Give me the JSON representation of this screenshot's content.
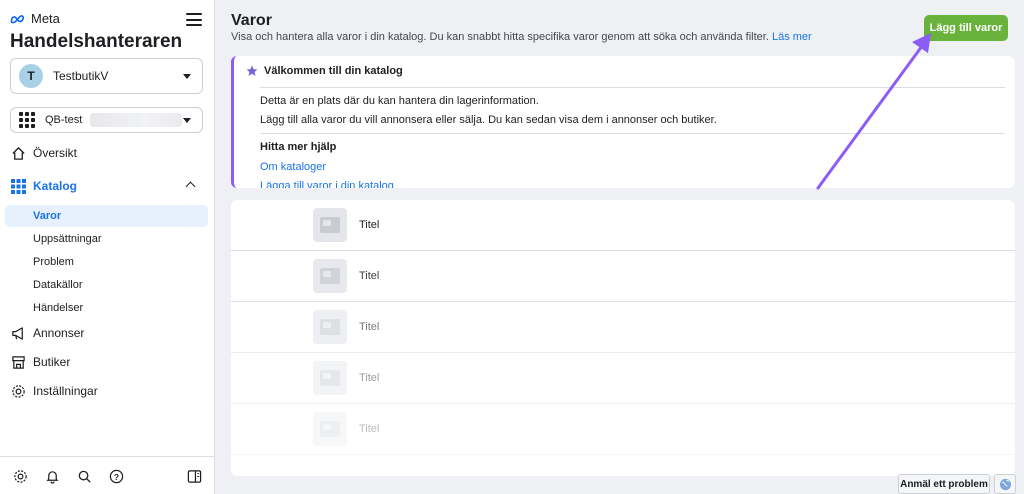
{
  "sidebar": {
    "brand": "Meta",
    "app_title": "Handelshanteraren",
    "account": {
      "avatar_letter": "T",
      "name": "TestbutikV"
    },
    "catalog": {
      "name": "QB-test"
    },
    "nav": {
      "overview": "Översikt",
      "catalog": "Katalog",
      "ads": "Annonser",
      "shops": "Butiker",
      "settings": "Inställningar"
    },
    "catalog_sub": [
      "Varor",
      "Uppsättningar",
      "Problem",
      "Datakällor",
      "Händelser"
    ],
    "bottom_icons": [
      "gear-icon",
      "bell-icon",
      "search-icon",
      "help-icon",
      "panel-icon"
    ]
  },
  "main": {
    "title": "Varor",
    "description": "Visa och hantera alla varor i din katalog. Du kan snabbt hitta specifika varor genom att söka och använda filter.",
    "learn_more": "Läs mer",
    "add_button": "Lägg till varor",
    "welcome": {
      "heading": "Välkommen till din katalog",
      "line1": "Detta är en plats där du kan hantera din lagerinformation.",
      "line2": "Lägg till alla varor du vill annonsera eller sälja. Du kan sedan visa dem i annonser och butiker.",
      "help_heading": "Hitta mer hjälp",
      "link1": "Om kataloger",
      "link2": "Lägga till varor i din katalog"
    },
    "items": [
      {
        "title": "Titel"
      },
      {
        "title": "Titel"
      },
      {
        "title": "Titel"
      },
      {
        "title": "Titel"
      },
      {
        "title": "Titel"
      }
    ]
  },
  "footer": {
    "report_problem": "Anmäl ett problem"
  },
  "colors": {
    "accent": "#1b74e4",
    "add_button": "#69b33d",
    "highlight": "#8b5cf6"
  }
}
